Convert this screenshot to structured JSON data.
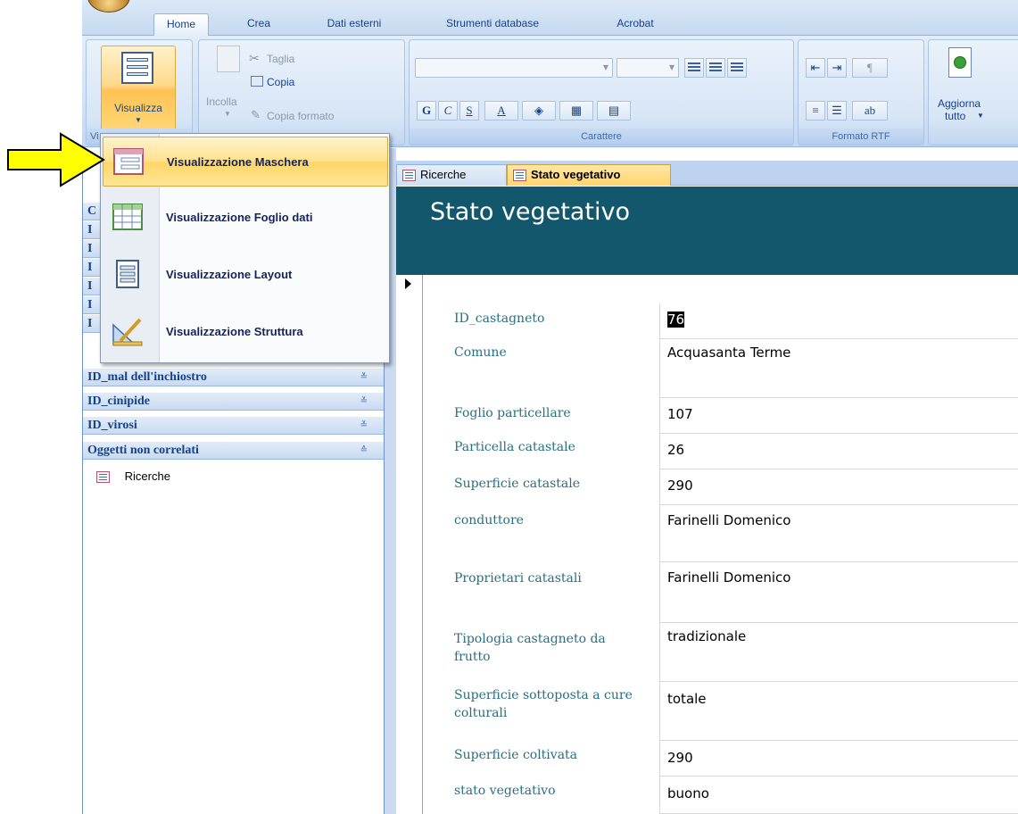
{
  "ribbon": {
    "tabs": [
      "Home",
      "Crea",
      "Dati esterni",
      "Strumenti database",
      "Acrobat"
    ],
    "visualizza_label": "Visualizza",
    "paste_label": "Incolla",
    "cut_label": "Taglia",
    "copy_label": "Copia",
    "copy_format_label": "Copia formato",
    "bold_label": "G",
    "italic_label": "C",
    "underline_label": "S",
    "group_font_label": "Carattere",
    "group_rtf_label": "Formato RTF",
    "refresh_label_1": "Aggiorna",
    "refresh_label_2": "tutto",
    "group_views_partial": "Vi"
  },
  "view_menu": {
    "items": [
      {
        "label": "Visualizzazione Maschera"
      },
      {
        "label": "Visualizzazione Foglio dati"
      },
      {
        "label": "Visualizzazione Layout"
      },
      {
        "label": "Visualizzazione Struttura"
      }
    ]
  },
  "navpane": {
    "hidden_initials": [
      "C",
      "I",
      "I",
      "I",
      "I",
      "I",
      "I"
    ],
    "categories": [
      {
        "label": "ID_mal dell'inchiostro",
        "chevron": "≚"
      },
      {
        "label": "ID_cinipide",
        "chevron": "≚"
      },
      {
        "label": "ID_virosi",
        "chevron": "≚"
      },
      {
        "label": "Oggetti non correlati",
        "chevron": "≙"
      }
    ],
    "objects": [
      {
        "label": "Ricerche"
      }
    ]
  },
  "document": {
    "tabs": [
      {
        "label": "Ricerche",
        "active": false
      },
      {
        "label": "Stato vegetativo",
        "active": true
      }
    ],
    "form_title": "Stato vegetativo",
    "fields": [
      {
        "label": "ID_castagneto",
        "value": "76"
      },
      {
        "label": "Comune",
        "value": "Acquasanta Terme"
      },
      {
        "label": "Foglio particellare",
        "value": "107"
      },
      {
        "label": "Particella catastale",
        "value": "26"
      },
      {
        "label": "Superficie catastale",
        "value": "290"
      },
      {
        "label": "conduttore",
        "value": "Farinelli Domenico"
      },
      {
        "label": "Proprietari catastali",
        "value": "Farinelli Domenico"
      },
      {
        "label": "Tipologia castagneto da frutto",
        "value": "tradizionale"
      },
      {
        "label": "Superficie sottoposta a cure colturali",
        "value": "totale"
      },
      {
        "label": "Superficie coltivata",
        "value": "290"
      },
      {
        "label": "stato vegetativo",
        "value": "buono"
      }
    ]
  },
  "colors": {
    "header_bg": "#12576b",
    "label_color": "#2a6f80",
    "highlight": "#ffd666",
    "pointer_arrow": "#ffff00"
  }
}
